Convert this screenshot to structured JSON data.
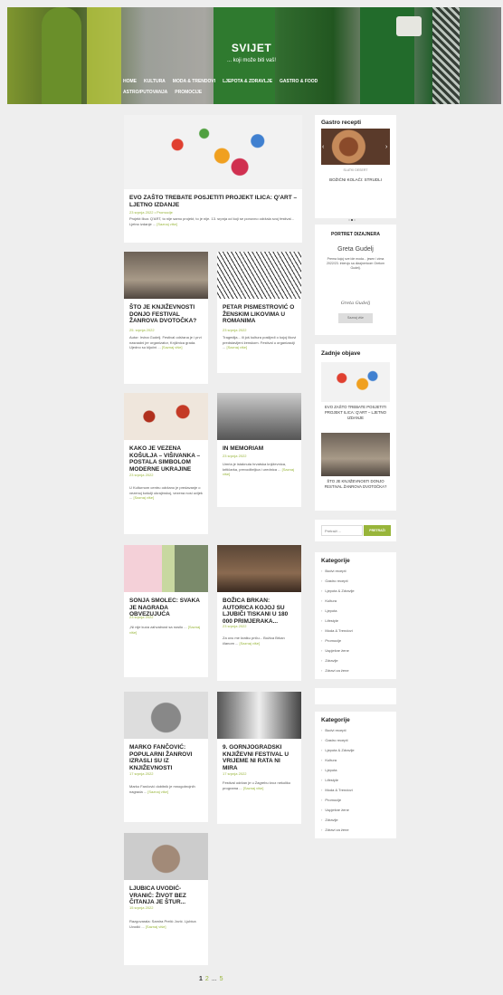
{
  "site": {
    "title": "SVIJET",
    "tagline": "... koji može biti vaš!"
  },
  "nav": {
    "row1": [
      "Home",
      "Kultura",
      "Moda & Trendovi",
      "Ljepota & Zdravlje",
      "Gastro & Food"
    ],
    "row2": [
      "Astro/Putovanja",
      "Promocije"
    ]
  },
  "posts": [
    {
      "title": "EVO ZAŠTO TREBATE POSJETITI PROJEKT ILICA: Q'ART – LJETNO IZDANJE",
      "date": "23 srpnja 2022 • Promocije",
      "excerpt": "Projekt Ilica: Q'ART, to nije samo projekt, to je nije. 13. srpnja od koji se ponovno održala svoj festival... Ljetno izdanje ...",
      "more": "[Saznaj više]"
    },
    {
      "title": "ŠTO JE KNJIŽEVNOSTI DONJO FESTIVAL ŽANROVA DVOTOČKA?",
      "date": "25. srpnja 2022",
      "excerpt": "Autor: Irvina Gudelj. Festival održana je i prvi nasnadni jer organizator, Knjižnica grada. Ujedno su ključni ...",
      "more": "[Saznaj više]"
    },
    {
      "title": "PETAR PISMESTROVIĆ O ŽENSKIM LIKOVIMA U ROMANIMA",
      "date": "23 srpnja 2022",
      "excerpt": "Tragedija... ili još kultura poslijedi o kojoj likovi predstavljeni ženskom. Festival u organizaciji ...",
      "more": "[Saznaj više]"
    },
    {
      "title": "KAKO JE VEZENA KOŠULJA – VIŠIVANKA – POSTALA SIMBOLOM MODERNE UKRAJINE",
      "date": "23 srpnja 2022",
      "excerpt": "U Kulturnom centru održano je predavanje o vezenoj košulji ukrajinskoj, vezena nosi uvijek ...",
      "more": "[Saznaj više]"
    },
    {
      "title": "IN MEMORIAM",
      "date": "23 srpnja 2022",
      "excerpt": "Umrla je istaknuta hrvatska književnica, kritičarka, prevoditeljica i urednica ...",
      "more": "[Saznaj više]"
    },
    {
      "title": "SONJA SMOLEC: SVAKA JE NAGRADA OBVEZUJUĆA",
      "date": "23 srpnja 2022",
      "excerpt": "„Ni nije kuća zahvalnost sa nosilo ...",
      "more": "[Saznaj više]"
    },
    {
      "title": "BOŽICA BRKAN: AUTORICA KOJOJ SU LJUBIČI TISKANI U 180 000 PRIMJERAKA...",
      "date": "23 srpnja 2022",
      "excerpt": "Za ovu me kratku priču... Božica Brkan članom ...",
      "more": "[Saznaj više]"
    },
    {
      "title": "MARKO FANČOVIĆ: POPULARNI ŽANROVI IZRASLI SU IZ KNJIŽEVNOSTI",
      "date": "17 srpnja 2022",
      "excerpt": "Marko Fančović dobitnik je mnogobrojnih nagrada ...",
      "more": "[Saznaj više]"
    },
    {
      "title": "9. GORNJOGRADSKI KNJIŽEVNI FESTIVAL U VRIJEME NI RATA NI MIRA",
      "date": "17 srpnja 2022",
      "excerpt": "Festival održan je u Zagrebu kroz nekoliko programa ...",
      "more": "[Saznaj više]"
    },
    {
      "title": "LJUBICA UVODIĆ-VRANIĆ: ŽIVOT BEZ ČITANJA JE ŠTUR...",
      "date": "15 srpnja 2022",
      "excerpt": "Razgovarala: Samira Prelić Jović. Ljubica Uvodić ...",
      "more": "[Saznaj više]"
    }
  ],
  "widgets": {
    "gastro": {
      "title": "Gastro recepti",
      "caption": "BOŽIĆNI KOLAČI: STRUDLI",
      "sub": "SLATKI DESERT"
    },
    "designer": {
      "title": "PORTRET DIZAJNERA",
      "name": "Greta Gudelj",
      "text": "Prema kojoj sve ide moda... jesen i zima 2022/23. Intervju sa dizajnericom Gretom Gudelj.",
      "signature": "Greta Gudelj",
      "button": "Saznaj više"
    },
    "latest": {
      "title": "Zadnje objave",
      "items": [
        "EVO ZAŠTO TREBATE POSJETITI PROJEKT ILICA: Q'ART – LJETNO IZDANJE",
        "ŠTO JE KNJIŽEVNOSTI DONJO FESTIVAL ŽANROVA DVOTOČKA?"
      ]
    },
    "search": {
      "placeholder": "Pretraži ...",
      "button": "PRETRAŽI"
    },
    "categories": {
      "title": "Kategorije",
      "items": [
        "Bodvi recepti",
        "Gastro recepti",
        "Ljepota & Zdravlje",
        "Kultura",
        "Ljepota",
        "Lifestyle",
        "Moda & Trendovi",
        "Promocije",
        "Uspješne žene",
        "Zdravlje",
        "Zdravi za žene"
      ]
    }
  },
  "pagination": {
    "pages": [
      "1",
      "2",
      "...",
      "5"
    ]
  },
  "colors": {
    "accent": "#98b53a",
    "background": "#eeeeee"
  }
}
